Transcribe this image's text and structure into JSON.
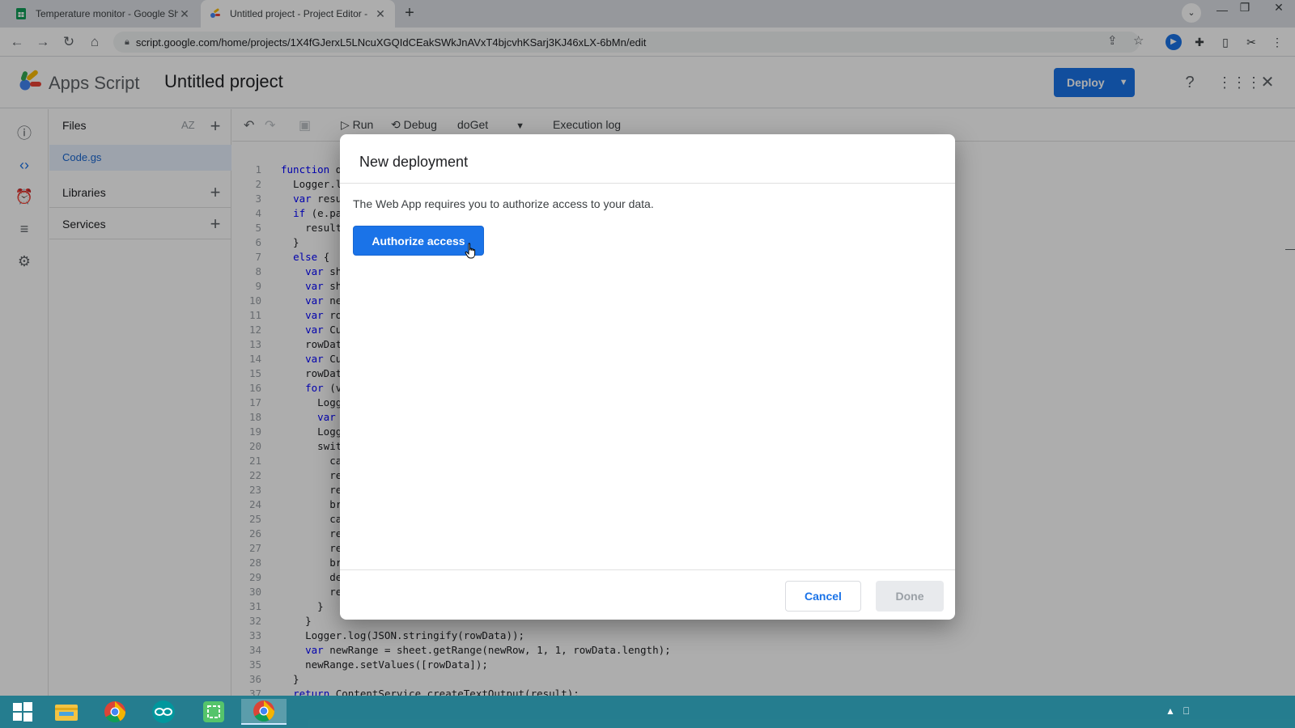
{
  "browser": {
    "tabs": [
      {
        "title": "Temperature monitor - Google Sh",
        "icon": "google-sheets-icon"
      },
      {
        "title": "Untitled project - Project Editor -",
        "icon": "apps-script-icon"
      }
    ],
    "new_tab": "+",
    "url": "script.google.com/home/projects/1X4fGJerxL5LNcuXGQIdCEakSWkJnAVxT4bjcvhKSarj3KJ46xLX-6bMn/edit"
  },
  "app": {
    "name": "Apps Script",
    "project_title": "Untitled project",
    "deploy_label": "Deploy",
    "colors": {
      "primary": "#1a73e8",
      "scrim": "rgba(0,0,0,0.32)"
    }
  },
  "sidebar": {
    "files_label": "Files",
    "sort_label": "AZ",
    "file_name": "Code.gs",
    "libraries_label": "Libraries",
    "services_label": "Services"
  },
  "toolbar": {
    "run_label": "Run",
    "debug_label": "Debug",
    "function_name": "doGet",
    "execution_log_label": "Execution log"
  },
  "code": {
    "lines": [
      {
        "n": "1",
        "text": "function d"
      },
      {
        "n": "2",
        "text": "  Logger.l"
      },
      {
        "n": "3",
        "text": "  var resu"
      },
      {
        "n": "4",
        "text": "  if (e.pa"
      },
      {
        "n": "5",
        "text": "    result"
      },
      {
        "n": "6",
        "text": "  }"
      },
      {
        "n": "7",
        "text": "  else {"
      },
      {
        "n": "8",
        "text": "    var sh"
      },
      {
        "n": "9",
        "text": "    var sh"
      },
      {
        "n": "10",
        "text": "    var ne"
      },
      {
        "n": "11",
        "text": "    var ro"
      },
      {
        "n": "12",
        "text": "    var Cu"
      },
      {
        "n": "13",
        "text": "    rowDat"
      },
      {
        "n": "14",
        "text": "    var Cu"
      },
      {
        "n": "15",
        "text": "    rowDat"
      },
      {
        "n": "16",
        "text": "    for (v"
      },
      {
        "n": "17",
        "text": "      Logg"
      },
      {
        "n": "18",
        "text": "      var"
      },
      {
        "n": "19",
        "text": "      Logg"
      },
      {
        "n": "20",
        "text": "      swit"
      },
      {
        "n": "21",
        "text": "        ca"
      },
      {
        "n": "22",
        "text": "        re"
      },
      {
        "n": "23",
        "text": "        re"
      },
      {
        "n": "24",
        "text": "        br"
      },
      {
        "n": "25",
        "text": "        ca"
      },
      {
        "n": "26",
        "text": "        re"
      },
      {
        "n": "27",
        "text": "        re"
      },
      {
        "n": "28",
        "text": "        br"
      },
      {
        "n": "29",
        "text": "        de"
      },
      {
        "n": "30",
        "text": "        re"
      },
      {
        "n": "31",
        "text": "      }"
      },
      {
        "n": "32",
        "text": "    }"
      },
      {
        "n": "33",
        "text": "    Logger.log(JSON.stringify(rowData));"
      },
      {
        "n": "34",
        "text": "    var newRange = sheet.getRange(newRow, 1, 1, rowData.length);"
      },
      {
        "n": "35",
        "text": "    newRange.setValues([rowData]);"
      },
      {
        "n": "36",
        "text": "  }"
      },
      {
        "n": "37",
        "text": "  return ContentService.createTextOutput(result);"
      }
    ]
  },
  "dialog": {
    "title": "New deployment",
    "message": "The Web App requires you to authorize access to your data.",
    "authorize_label": "Authorize access",
    "cancel_label": "Cancel",
    "done_label": "Done"
  }
}
